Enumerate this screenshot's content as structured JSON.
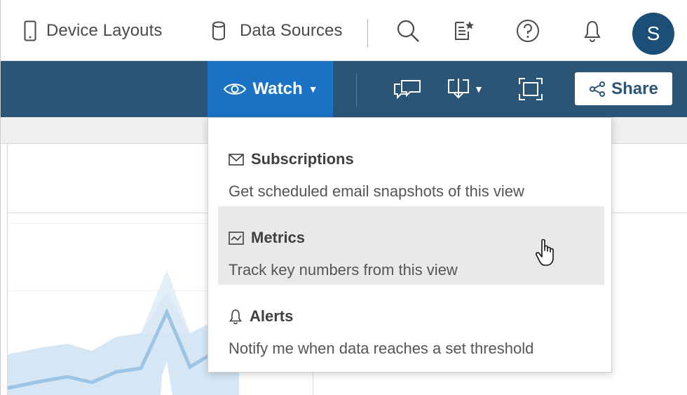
{
  "topbar": {
    "device_layouts_label": "Device Layouts",
    "data_sources_label": "Data Sources",
    "avatar_initial": "S"
  },
  "toolbar": {
    "watch_label": "Watch",
    "share_label": "Share"
  },
  "watch_menu": {
    "items": [
      {
        "title": "Subscriptions",
        "description": "Get scheduled email snapshots of this view",
        "icon": "envelope-icon"
      },
      {
        "title": "Metrics",
        "description": "Track key numbers from this view",
        "icon": "metrics-icon"
      },
      {
        "title": "Alerts",
        "description": "Notify me when data reaches a set threshold",
        "icon": "bell-icon"
      }
    ],
    "hovered_item": "Metrics"
  },
  "colors": {
    "toolbar_bg": "#2b5577",
    "watch_active": "#1a73c4",
    "avatar_bg": "#1c4f78",
    "menu_hover": "#e9e9e9",
    "chart_band": "#d5e6f5",
    "chart_line": "#9cc4e4"
  }
}
